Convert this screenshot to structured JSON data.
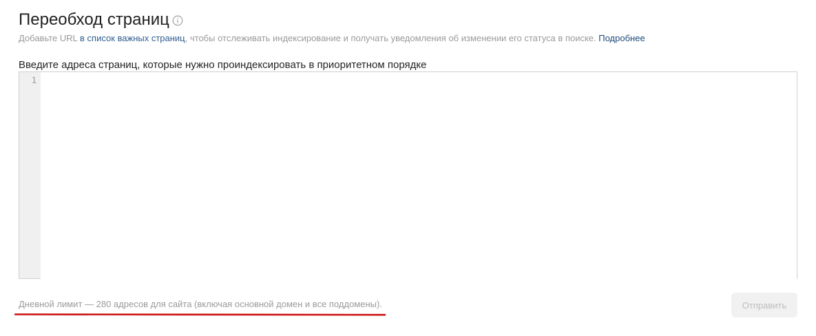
{
  "page": {
    "title": "Переобход страниц",
    "title_info_icon": "info-circle-icon"
  },
  "subtitle": {
    "prefix": "Добавьте URL ",
    "link_important_pages": "в список важных страниц",
    "middle": ", чтобы отслеживать индексирование и получать уведомления об изменении его статуса в поиске. ",
    "link_more": "Подробнее"
  },
  "editor": {
    "label": "Введите адреса страниц, которые нужно проиндексировать в приоритетном порядке",
    "line_number": "1",
    "value": ""
  },
  "footer": {
    "limit_text": "Дневной лимит — 280 адресов для сайта (включая основной домен и все поддомены).",
    "submit_label": "Отправить",
    "annotation_color": "#cc1010"
  },
  "colors": {
    "link": "#2f5d8f",
    "muted_text": "#9a9a9a",
    "disabled_button_bg": "#f1f1f1"
  }
}
